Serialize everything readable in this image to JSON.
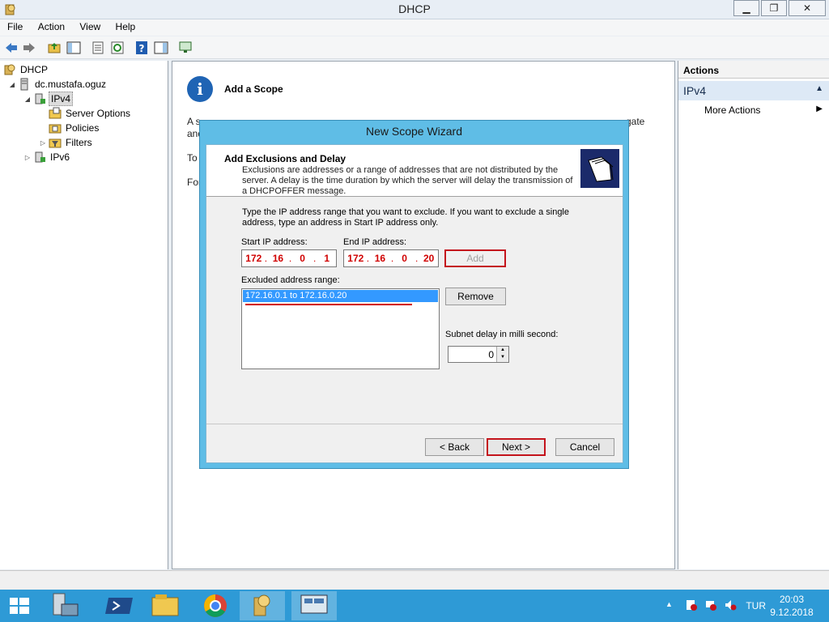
{
  "window": {
    "title": "DHCP",
    "buttons": {
      "minimize": "▁",
      "restore": "❐",
      "close": "✕"
    }
  },
  "menu": [
    "File",
    "Action",
    "View",
    "Help"
  ],
  "tree": {
    "root": "DHCP",
    "server": "dc.mustafa.oguz",
    "ipv4": "IPv4",
    "server_options": "Server Options",
    "policies": "Policies",
    "filters": "Filters",
    "ipv6": "IPv6"
  },
  "center": {
    "title": "Add a Scope",
    "bg_line1": "A s",
    "bg_line1_r": "gate",
    "bg_line2": "and",
    "bg_line3": "To",
    "bg_line4": "For"
  },
  "actions": {
    "header": "Actions",
    "section": "IPv4",
    "more": "More Actions"
  },
  "wizard": {
    "title": "New Scope Wizard",
    "header_title": "Add Exclusions and Delay",
    "header_desc": "Exclusions are addresses or a range of addresses that are not distributed by the server. A delay is the time duration by which the server will delay the transmission of a DHCPOFFER message.",
    "instructions": "Type the IP address range that you want to exclude. If you want to exclude a single address, type an address in Start IP address only.",
    "start_ip_label": "Start IP address:",
    "end_ip_label": "End IP address:",
    "start_ip": [
      "172",
      "16",
      "0",
      "1"
    ],
    "end_ip": [
      "172",
      "16",
      "0",
      "20"
    ],
    "add_button": "Add",
    "excluded_label": "Excluded address range:",
    "excluded_items": [
      "172.16.0.1 to 172.16.0.20"
    ],
    "remove_button": "Remove",
    "delay_label": "Subnet delay in milli second:",
    "delay_value": "0",
    "back_button": "< Back",
    "next_button": "Next >",
    "cancel_button": "Cancel"
  },
  "taskbar": {
    "lang": "TUR",
    "time": "20:03",
    "date": "9.12.2018"
  },
  "colors": {
    "accent": "#2e9ad6",
    "wizard_frame": "#5fbde6",
    "highlight": "#c4141c",
    "selection": "#3399ff"
  }
}
